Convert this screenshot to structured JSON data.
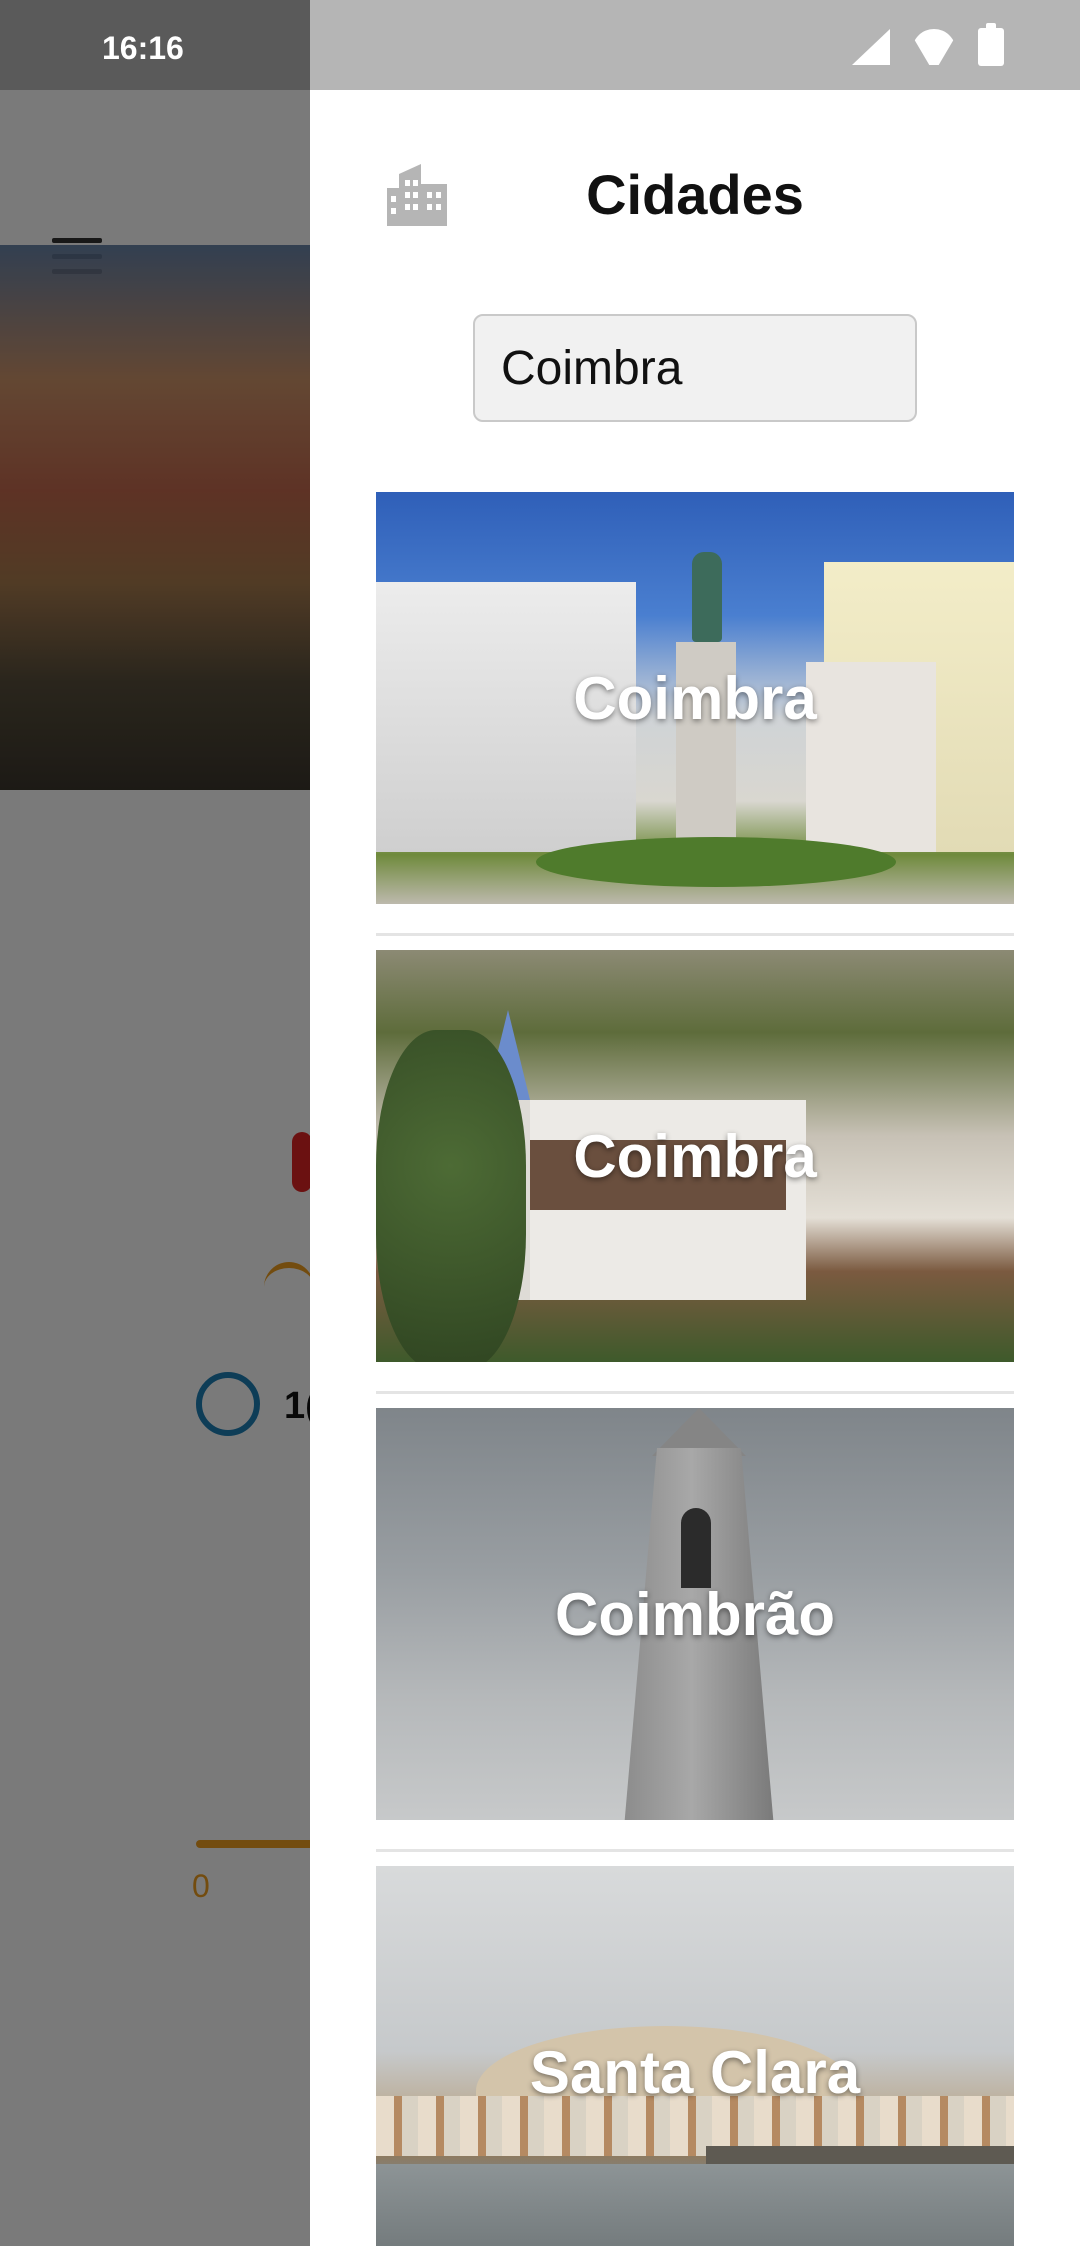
{
  "status_bar": {
    "time": "16:16",
    "icons": [
      "signal-icon",
      "wifi-icon",
      "battery-icon"
    ]
  },
  "background_app": {
    "menu_icon": "hamburger-menu-icon",
    "partial_value": "1(",
    "slider_min": "0"
  },
  "drawer": {
    "icon": "city-buildings-icon",
    "title": "Cidades",
    "search": {
      "value": "Coimbra"
    },
    "results": [
      {
        "label": "Coimbra",
        "image": "coimbra-square-statue"
      },
      {
        "label": "Coimbra",
        "image": "town-with-church"
      },
      {
        "label": "Coimbrão",
        "image": "bell-tower"
      },
      {
        "label": "Santa Clara",
        "image": "river-city-view"
      }
    ]
  },
  "colors": {
    "scrim": "#000000",
    "accent_orange": "#f0a020",
    "accent_blue": "#1f7fb6",
    "thermo_red": "#e02424"
  }
}
